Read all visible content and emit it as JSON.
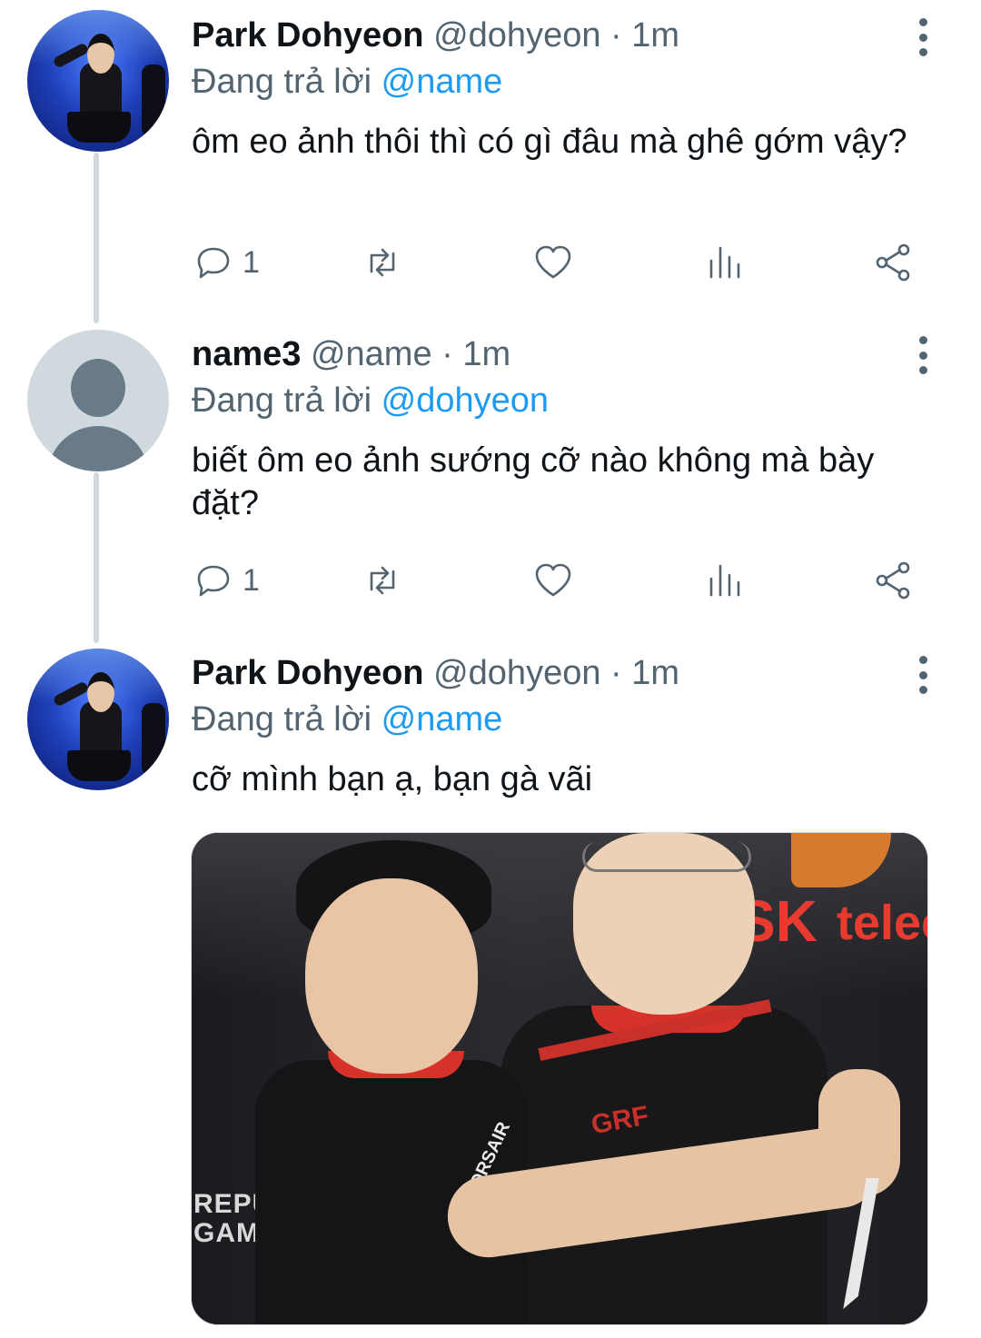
{
  "thread": [
    {
      "display_name": "Park Dohyeon",
      "handle": "@dohyeon",
      "separator": "·",
      "time": "1m",
      "reply_prefix": "Đang trả lời",
      "reply_to": "@name",
      "text": "ôm eo ảnh thôi thì có gì đâu mà ghê gớm vậy?",
      "avatar": "player-photo",
      "reply_count": "1",
      "retweet_count": "",
      "like_count": ""
    },
    {
      "display_name": "name3",
      "handle": "@name",
      "separator": "·",
      "time": "1m",
      "reply_prefix": "Đang trả lời",
      "reply_to": "@dohyeon",
      "text": "biết ôm eo ảnh sướng cỡ nào không mà bày đặt?",
      "avatar": "default-avatar",
      "reply_count": "1",
      "retweet_count": "",
      "like_count": ""
    },
    {
      "display_name": "Park Dohyeon",
      "handle": "@dohyeon",
      "separator": "·",
      "time": "1m",
      "reply_prefix": "Đang trả lời",
      "reply_to": "@name",
      "text": "cỡ mình bạn ạ, bạn gà vãi",
      "avatar": "player-photo",
      "media": {
        "kind": "photo",
        "sign_text_1": "SK",
        "sign_text_2": "telec",
        "banner_text_1": "REPUBLI",
        "banner_text_2": "GAMERS",
        "jersey_text_1": "GRF",
        "jersey_text_2": "CORSAIR"
      }
    }
  ],
  "icons": {
    "reply": "reply-icon",
    "retweet": "retweet-icon",
    "like": "heart-icon",
    "views": "analytics-icon",
    "share": "share-icon",
    "more": "more-vertical-icon"
  },
  "colors": {
    "text_primary": "#0f1419",
    "text_secondary": "#536471",
    "mention": "#1d9bf0",
    "thread_line": "#cfd9de",
    "default_avatar_bg": "#cfd9de",
    "default_avatar_fg": "#697b89"
  }
}
